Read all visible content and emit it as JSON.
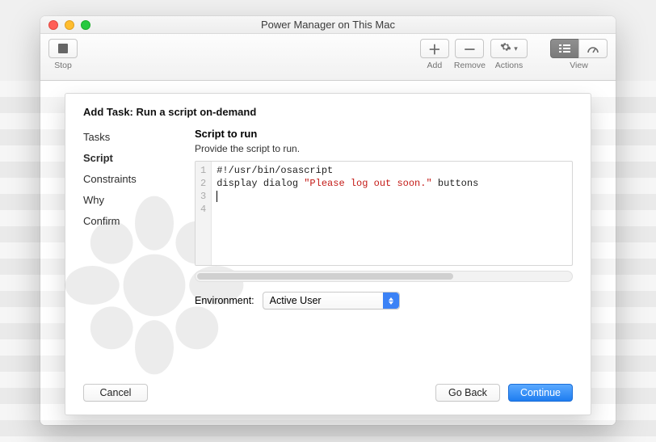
{
  "window": {
    "title": "Power Manager on This Mac"
  },
  "toolbar": {
    "stop_label": "Stop",
    "add_label": "Add",
    "remove_label": "Remove",
    "actions_label": "Actions",
    "view_label": "View"
  },
  "sheet": {
    "heading": "Add Task: Run a script on-demand",
    "steps": {
      "tasks": "Tasks",
      "script": "Script",
      "constraints": "Constraints",
      "why": "Why",
      "confirm": "Confirm"
    },
    "main": {
      "title": "Script to run",
      "subtitle": "Provide the script to run."
    },
    "code": {
      "line1": "#!/usr/bin/osascript",
      "line2": "",
      "line3_pre": "display dialog ",
      "line3_str": "\"Please log out soon.\"",
      "line3_post": " buttons",
      "line4": ""
    },
    "gutter": {
      "l1": "1",
      "l2": "2",
      "l3": "3",
      "l4": "4"
    },
    "env": {
      "label": "Environment:",
      "value": "Active User"
    },
    "buttons": {
      "cancel": "Cancel",
      "back": "Go Back",
      "continue": "Continue"
    }
  }
}
